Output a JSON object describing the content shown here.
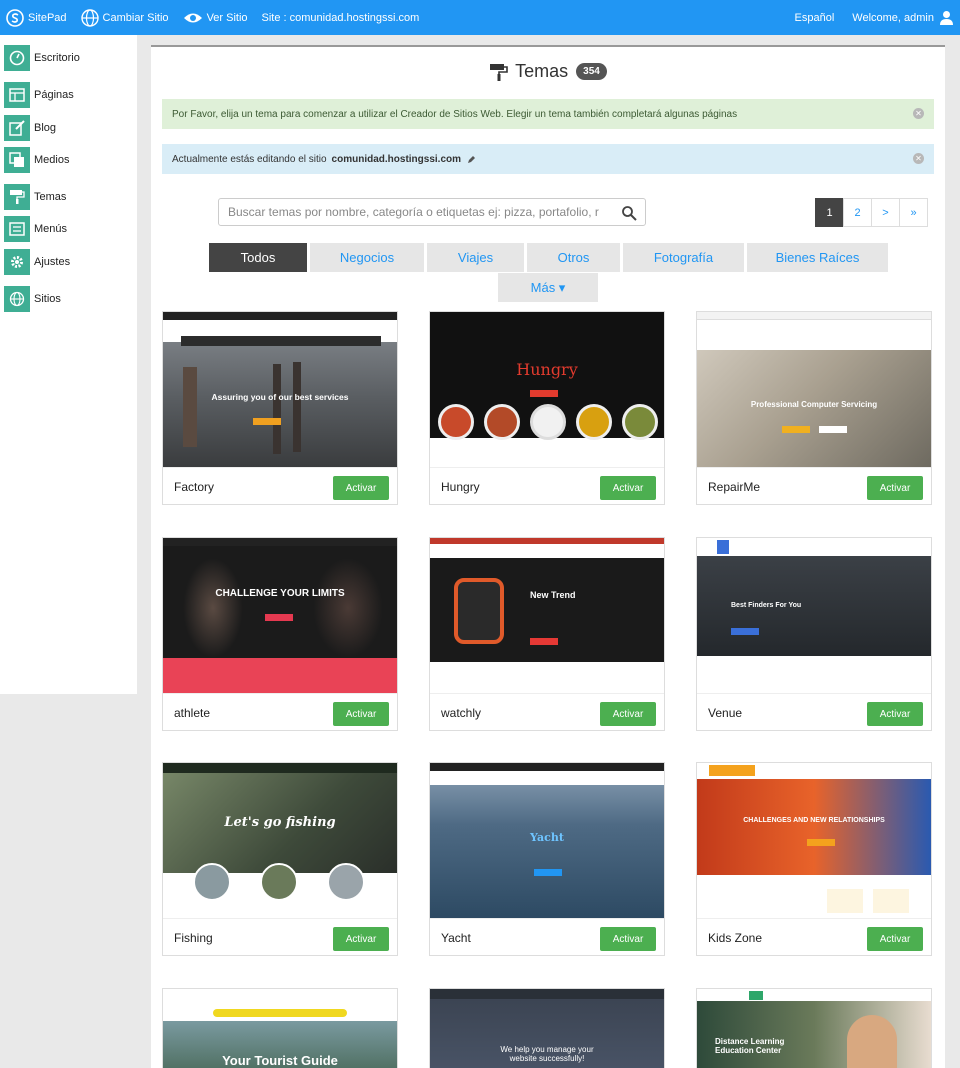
{
  "topbar": {
    "brand": "SitePad",
    "change_site": "Cambiar Sitio",
    "view_site": "Ver Sitio",
    "site_label": "Site : comunidad.hostingssi.com",
    "language": "Español",
    "welcome": "Welcome, admin"
  },
  "sidebar": {
    "items": [
      {
        "label": "Escritorio",
        "icon": "dashboard-icon"
      },
      {
        "label": "Páginas",
        "icon": "pages-icon"
      },
      {
        "label": "Blog",
        "icon": "blog-icon"
      },
      {
        "label": "Medios",
        "icon": "media-icon"
      },
      {
        "label": "Temas",
        "icon": "paint-roller-icon"
      },
      {
        "label": "Menús",
        "icon": "menu-icon"
      },
      {
        "label": "Ajustes",
        "icon": "gear-icon"
      },
      {
        "label": "Sitios",
        "icon": "globe-icon"
      }
    ]
  },
  "main": {
    "title": "Temas",
    "count": "354",
    "alert_success": "Por Favor, elija un tema para comenzar a utilizar el Creador de Sitios Web. Elegir un tema también completará algunas páginas",
    "alert_info_text": "Actualmente estás editando el sitio",
    "alert_info_site": "comunidad.hostingssi.com",
    "search_placeholder": "Buscar temas por nombre, categoría o etiquetas ej: pizza, portafolio, r",
    "pagination": [
      "1",
      "2",
      ">",
      "»"
    ],
    "tabs": [
      "Todos",
      "Negocios",
      "Viajes",
      "Otros",
      "Fotografía",
      "Bienes Raíces"
    ],
    "more_tab": "Más ▾",
    "activate_label": "Activar"
  },
  "themes": [
    {
      "name": "Factory",
      "headline": "Assuring you of our best services"
    },
    {
      "name": "Hungry",
      "headline": "Hungry"
    },
    {
      "name": "RepairMe",
      "headline": "Professional Computer Servicing"
    },
    {
      "name": "athlete",
      "headline": "CHALLENGE YOUR LIMITS"
    },
    {
      "name": "watchly",
      "headline": "New Trend"
    },
    {
      "name": "Venue",
      "headline": "Best Finders For You"
    },
    {
      "name": "Fishing",
      "headline": "Let's go fishing"
    },
    {
      "name": "Yacht",
      "headline": "Yacht"
    },
    {
      "name": "Kids Zone",
      "headline": "CHALLENGES AND NEW RELATIONSHIPS"
    },
    {
      "name": "",
      "headline": "Your Tourist Guide"
    },
    {
      "name": "",
      "headline": "We help you manage your website successfully!"
    },
    {
      "name": "",
      "headline": "Distance Learning Education Center"
    }
  ],
  "colors": {
    "topbar": "#2196f3",
    "sidebar_icon": "#3fae94",
    "activate": "#4caf50"
  }
}
